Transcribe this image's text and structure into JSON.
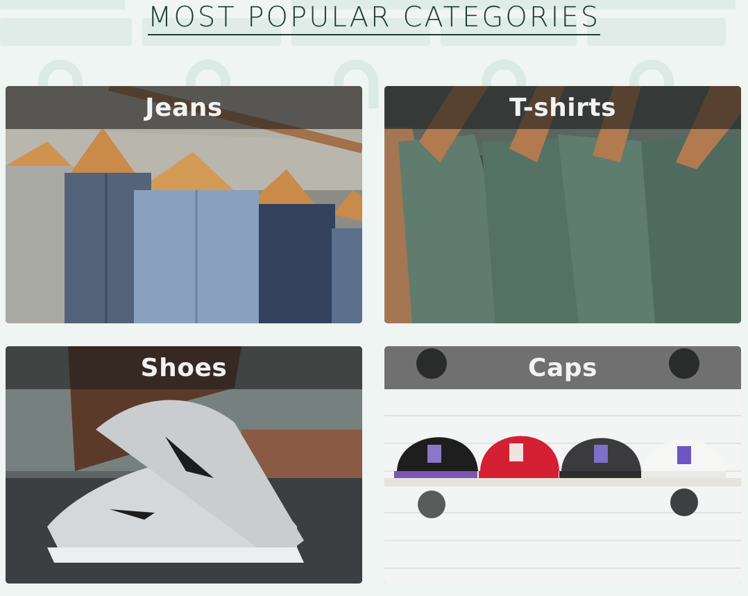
{
  "header": {
    "title": "MOST POPULAR CATEGORIES"
  },
  "categories": [
    {
      "label": "Jeans",
      "image": "jeans-on-hangers-photo"
    },
    {
      "label": "T-shirts",
      "image": "green-tshirts-on-hangers-photo"
    },
    {
      "label": "Shoes",
      "image": "grey-sneaker-photo"
    },
    {
      "label": "Caps",
      "image": "caps-on-shelf-photo"
    }
  ],
  "colors": {
    "background": "#eef5f2",
    "title": "#1d3c33",
    "label_bar": "rgba(30,30,30,0.62)",
    "label_text": "#f2f2f2"
  }
}
